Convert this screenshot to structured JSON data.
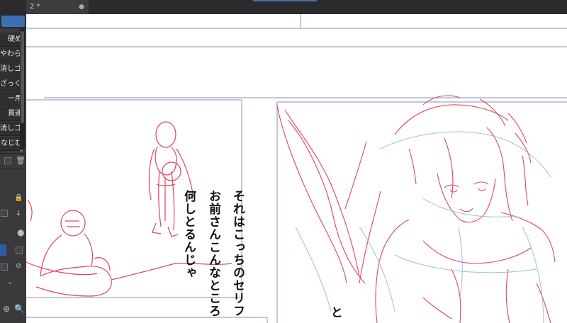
{
  "tabs": [
    {
      "label": "2 *",
      "close_icon": "dot"
    }
  ],
  "brush_list": [
    "硬め",
    "やわらかめ",
    "消しゴム",
    "ざっくり",
    "ー用",
    "貫通",
    "消しゴム",
    "なじむ"
  ],
  "speech": {
    "line1": "それはこっちのセリフ",
    "line2": "お前さんこんなところ",
    "line3": "何しとるんじゃ",
    "fragment": "と"
  },
  "colors": {
    "panel_bg": "#3a3a3c",
    "tab_bar": "#2b2b2d",
    "sketch_red": "#e0445f",
    "sketch_blue": "#8fb8e6",
    "frame_line": "#8a8fb8"
  }
}
